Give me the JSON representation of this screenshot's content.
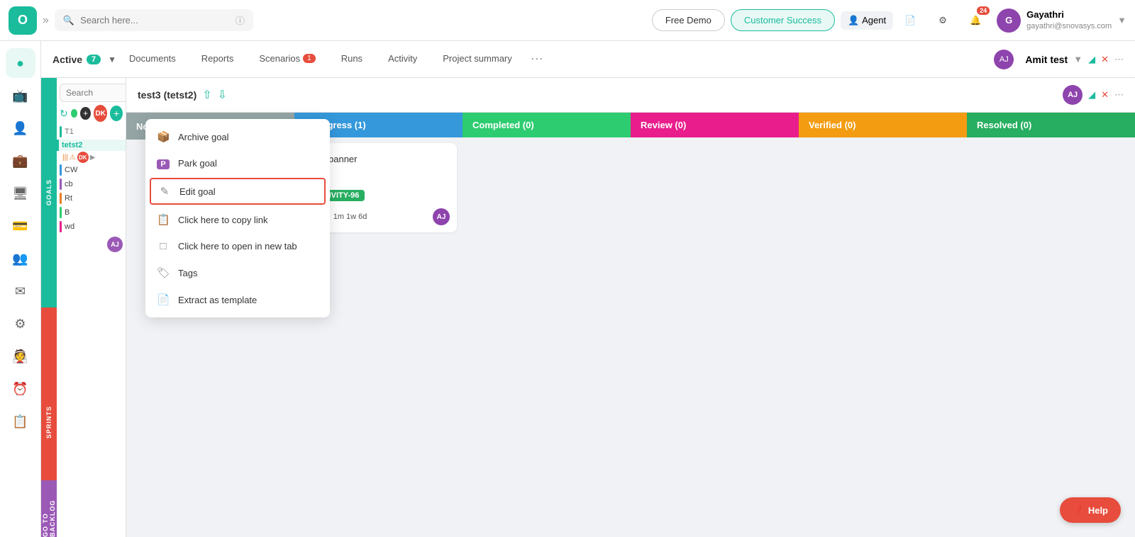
{
  "app": {
    "logo_text": "O",
    "logo_bg": "#1abc9c"
  },
  "topnav": {
    "search_placeholder": "Search here...",
    "free_demo_label": "Free Demo",
    "customer_success_label": "Customer Success",
    "agent_label": "Agent",
    "notification_count": "24",
    "user_name": "Gayathri",
    "user_email": "gayathri@snovasys.com",
    "user_initials": "G"
  },
  "subnav": {
    "active_label": "Active",
    "active_count": "7",
    "documents_label": "Documents",
    "reports_label": "Reports",
    "scenarios_label": "Scenarios",
    "scenarios_count": "1",
    "runs_label": "Runs",
    "activity_label": "Activity",
    "project_summary_label": "Project summary",
    "workspace_name": "Amit test",
    "workspace_initials": "AJ"
  },
  "goals_panel": {
    "goals_tab_label": "Goals",
    "sprints_tab_label": "Sprints",
    "backlog_tab_label": "Go to backlog",
    "search_placeholder": "Search",
    "goals": [
      {
        "id": "T1",
        "label": "T1",
        "color": "#1abc9c"
      },
      {
        "id": "tetst2",
        "label": "tetst2",
        "color": "#e74c3c",
        "active": true
      },
      {
        "id": "CW",
        "label": "CW",
        "color": "#3498db"
      },
      {
        "id": "cb",
        "label": "cb",
        "color": "#9b59b6"
      },
      {
        "id": "Rt",
        "label": "Rt",
        "color": "#e67e22"
      },
      {
        "id": "B",
        "label": "B",
        "color": "#2ecc71"
      },
      {
        "id": "wd",
        "label": "wd",
        "color": "#e91e8c"
      }
    ],
    "dk_avatar": "DK"
  },
  "board": {
    "title": "test3 (tetst2)",
    "columns": [
      {
        "id": "not_started",
        "label": "Not Started (0)",
        "count": 0,
        "color": "#95a5a6",
        "css_class": "col-not-started"
      },
      {
        "id": "inprogress",
        "label": "Inprogress (1)",
        "count": 1,
        "color": "#3498db",
        "css_class": "col-inprogress"
      },
      {
        "id": "completed",
        "label": "Completed (0)",
        "count": 0,
        "color": "#2ecc71",
        "css_class": "col-completed"
      },
      {
        "id": "review",
        "label": "Review (0)",
        "count": 0,
        "color": "#e91e8c",
        "css_class": "col-review"
      },
      {
        "id": "verified",
        "label": "Verified (0)",
        "count": 0,
        "color": "#f39c12",
        "css_class": "col-verified"
      },
      {
        "id": "resolved",
        "label": "Resolved (0)",
        "count": 0,
        "color": "#27ae60",
        "css_class": "col-resolved"
      }
    ],
    "card": {
      "title": "banner",
      "activity_tag": "ACTIVITY-96",
      "time": "1m 1w 6d",
      "avatar_initials": "AJ"
    }
  },
  "context_menu": {
    "archive_label": "Archive goal",
    "park_label": "Park goal",
    "edit_label": "Edit goal",
    "copy_link_label": "Click here to copy link",
    "open_new_tab_label": "Click here to open in new tab",
    "tags_label": "Tags",
    "extract_template_label": "Extract as template"
  },
  "help_btn": {
    "label": "Help"
  }
}
